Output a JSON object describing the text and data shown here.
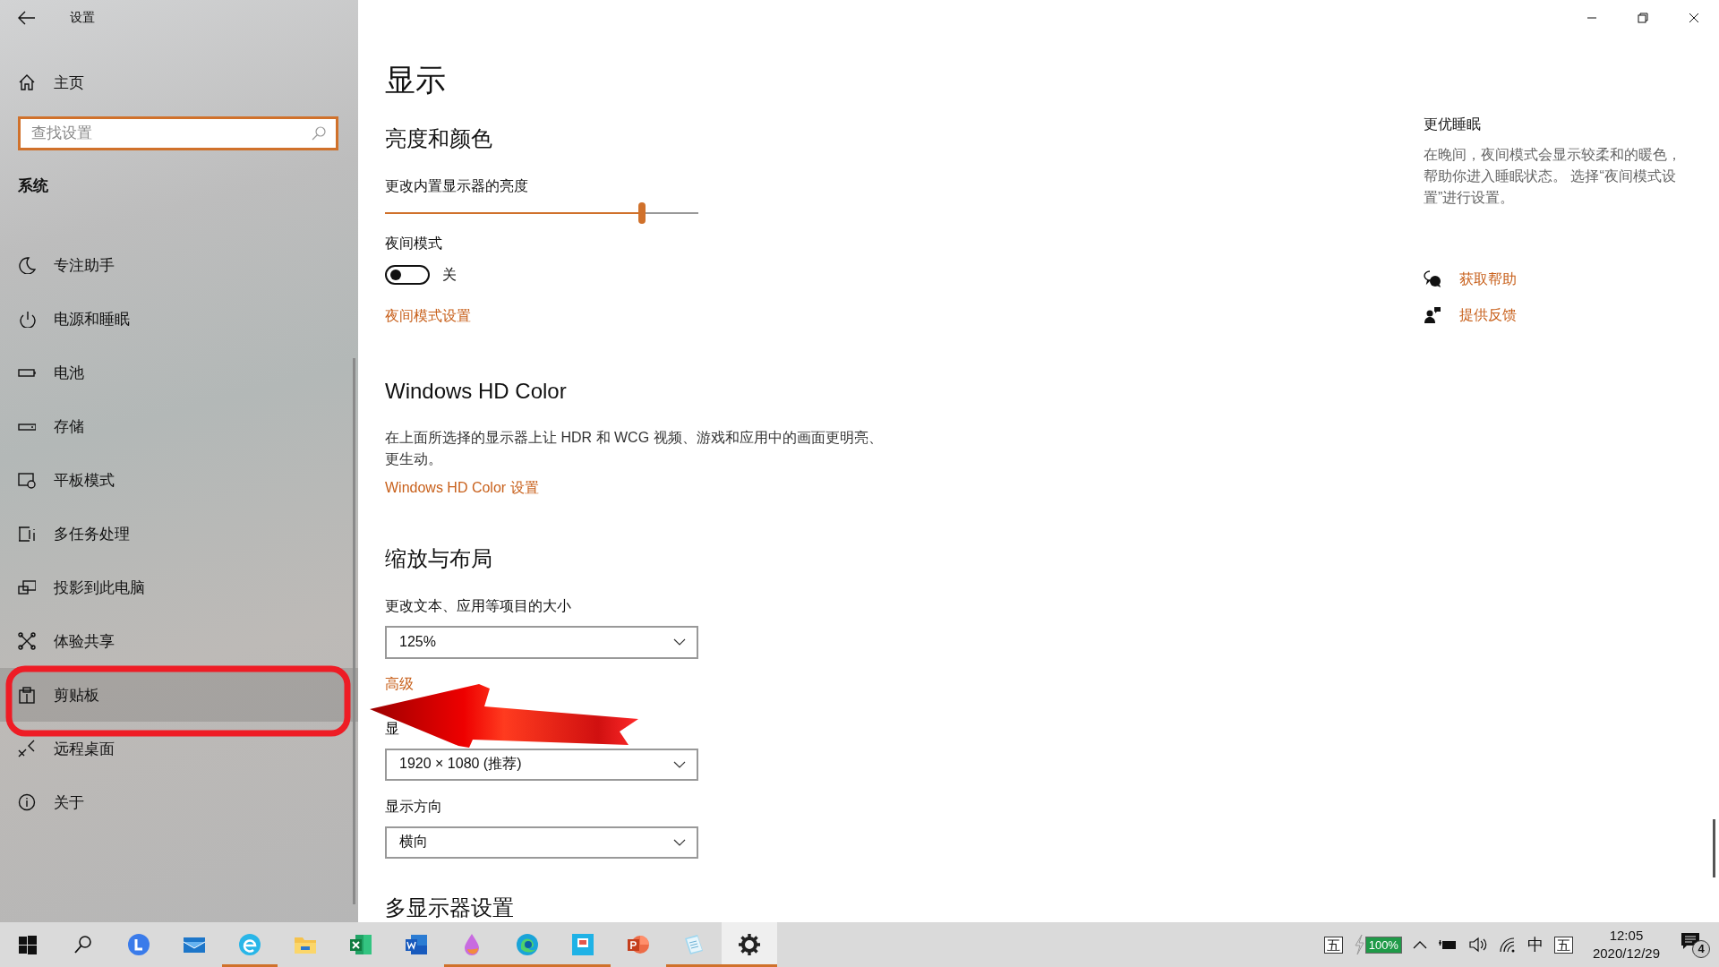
{
  "window": {
    "title": "设置"
  },
  "sidebar": {
    "home": "主页",
    "search": {
      "placeholder": "查找设置"
    },
    "section": "系统",
    "items": [
      {
        "kind": "moon",
        "label": "专注助手",
        "selected": false
      },
      {
        "kind": "power",
        "label": "电源和睡眠",
        "selected": false
      },
      {
        "kind": "battery",
        "label": "电池",
        "selected": false
      },
      {
        "kind": "storage",
        "label": "存储",
        "selected": false
      },
      {
        "kind": "tablet",
        "label": "平板模式",
        "selected": false
      },
      {
        "kind": "multitask",
        "label": "多任务处理",
        "selected": false
      },
      {
        "kind": "project",
        "label": "投影到此电脑",
        "selected": false
      },
      {
        "kind": "share",
        "label": "体验共享",
        "selected": false
      },
      {
        "kind": "clipboard",
        "label": "剪贴板",
        "selected": true
      },
      {
        "kind": "remote",
        "label": "远程桌面",
        "selected": false
      },
      {
        "kind": "info",
        "label": "关于",
        "selected": false
      }
    ]
  },
  "page": {
    "title": "显示",
    "brightness": {
      "heading": "亮度和颜色",
      "label": "更改内置显示器的亮度",
      "level": 0.82
    },
    "night_light": {
      "label": "夜间模式",
      "on": false,
      "state_text": "关",
      "link": "夜间模式设置"
    },
    "hd_color": {
      "heading": "Windows HD Color",
      "description": "在上面所选择的显示器上让 HDR 和 WCG 视频、游戏和应用中的画面更明亮、更生动。",
      "link": "Windows HD Color 设置"
    },
    "scale_layout": {
      "heading": "缩放与布局",
      "scale_label": "更改文本、应用等项目的大小",
      "scale_value": "125%",
      "advanced_link": "高级",
      "resolution_label": "显",
      "resolution_value": "1920 × 1080 (推荐)",
      "orientation_label": "显示方向",
      "orientation_value": "横向"
    },
    "multi_display": {
      "heading": "多显示器设置"
    }
  },
  "aside": {
    "title": "更优睡眠",
    "text": "在晚间，夜间模式会显示较柔和的暖色，帮助你进入睡眠状态。 选择“夜间模式设置”进行设置。",
    "links": [
      {
        "kind": "help",
        "label": "获取帮助"
      },
      {
        "kind": "feedback",
        "label": "提供反馈"
      }
    ]
  },
  "taskbar": {
    "apps": [
      {
        "kind": "start",
        "running": false,
        "selected": false
      },
      {
        "kind": "search",
        "running": false,
        "selected": false
      },
      {
        "kind": "circle-app",
        "running": false,
        "selected": false
      },
      {
        "kind": "mail",
        "running": false,
        "selected": false
      },
      {
        "kind": "e-app",
        "running": true,
        "selected": false
      },
      {
        "kind": "folder",
        "running": false,
        "selected": false
      },
      {
        "kind": "excel",
        "running": false,
        "selected": false
      },
      {
        "kind": "word",
        "running": false,
        "selected": false
      },
      {
        "kind": "paint",
        "running": true,
        "selected": false
      },
      {
        "kind": "edge",
        "running": true,
        "selected": false
      },
      {
        "kind": "tile-app",
        "running": true,
        "selected": false
      },
      {
        "kind": "powerpoint",
        "running": false,
        "selected": false
      },
      {
        "kind": "notepad",
        "running": true,
        "selected": false
      },
      {
        "kind": "settings",
        "running": true,
        "selected": true
      }
    ],
    "tray": {
      "ime": "五",
      "battery": "100%",
      "language": "中",
      "ime_mode": "五",
      "time": "12:05",
      "date": "2020/12/29",
      "notifications": "4"
    }
  }
}
